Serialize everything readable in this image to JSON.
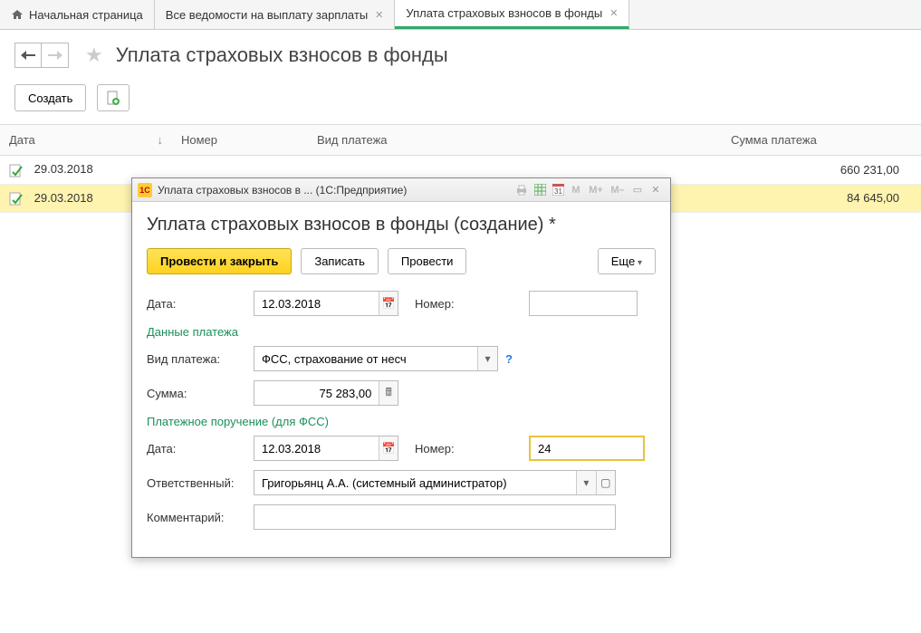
{
  "tabs": {
    "home": "Начальная страница",
    "all": "Все ведомости на выплату зарплаты",
    "pay": "Уплата страховых взносов в фонды"
  },
  "page": {
    "title": "Уплата страховых взносов в фонды"
  },
  "toolbar": {
    "create": "Создать"
  },
  "table": {
    "headers": {
      "date": "Дата",
      "number": "Номер",
      "type": "Вид платежа",
      "sum": "Сумма платежа"
    },
    "rows": [
      {
        "date": "29.03.2018",
        "sum": "660 231,00"
      },
      {
        "date": "29.03.2018",
        "sum": "84 645,00"
      }
    ]
  },
  "dialog": {
    "window_title": "Уплата страховых взносов в ... (1С:Предприятие)",
    "heading": "Уплата страховых взносов в фонды (создание) *",
    "buttons": {
      "post_close": "Провести и закрыть",
      "save": "Записать",
      "post": "Провести",
      "more": "Еще"
    },
    "labels": {
      "date": "Дата:",
      "number": "Номер:",
      "section1": "Данные платежа",
      "type": "Вид платежа:",
      "sum": "Сумма:",
      "section2": "Платежное поручение (для ФСС)",
      "resp": "Ответственный:",
      "comment": "Комментарий:"
    },
    "values": {
      "date": "12.03.2018",
      "type": "ФСС, страхование от несч",
      "sum": "75 283,00",
      "order_date": "12.03.2018",
      "order_number": "24",
      "resp": "Григорьянц А.А. (системный администратор)"
    },
    "titlebar_m": {
      "m": "M",
      "mplus": "M+",
      "mminus": "M–"
    }
  }
}
